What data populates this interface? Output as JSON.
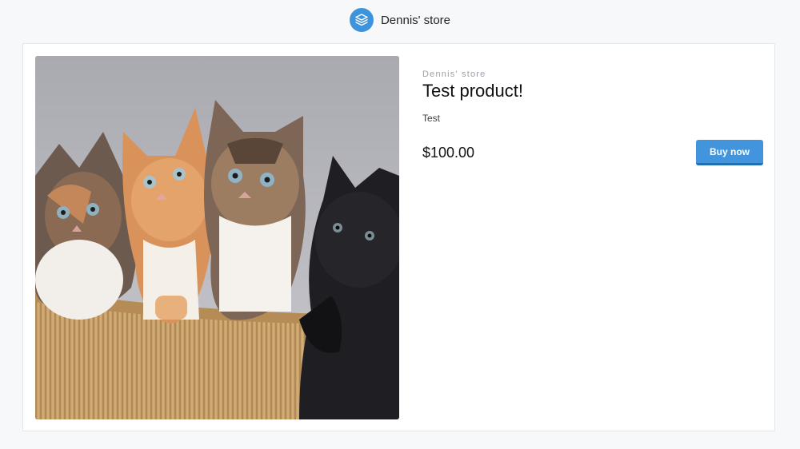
{
  "header": {
    "store_name": "Dennis' store",
    "logo_icon": "layers-icon",
    "brand_color": "#3e94dc"
  },
  "product": {
    "store_label": "Dennis' store",
    "name": "Test product!",
    "description": "Test",
    "price": "$100.00",
    "image_subject": "kittens-photo"
  },
  "actions": {
    "buy_label": "Buy now",
    "buy_color": "#4295dd",
    "buy_border_color": "#1f6fb4"
  }
}
